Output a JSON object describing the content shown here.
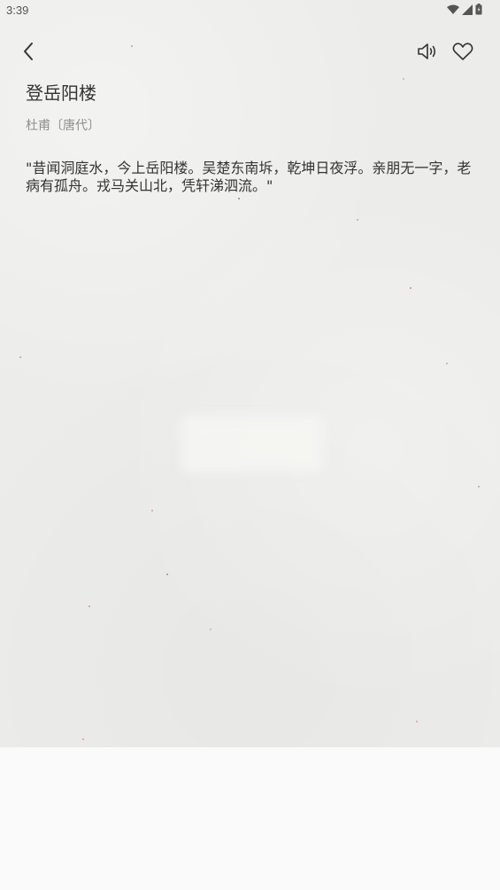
{
  "status_bar": {
    "time": "3:39",
    "icons": [
      "wifi-icon",
      "cellular-signal-icon",
      "battery-icon"
    ]
  },
  "toolbar": {
    "back_icon": "chevron-left-icon",
    "read_aloud_icon": "speaker-icon",
    "favorite_icon": "heart-outline-icon"
  },
  "poem": {
    "title": "登岳阳楼",
    "author": "杜甫〔唐代〕",
    "content": "\"昔闻洞庭水，今上岳阳楼。吴楚东南坼，乾坤日夜浮。亲朋无一字，老病有孤舟。戎马关山北，凭轩涕泗流。\""
  },
  "colors": {
    "paper_background": "#ececea",
    "text_primary": "#333333",
    "text_secondary": "#8e8e8e",
    "page_background": "#fafafa"
  }
}
